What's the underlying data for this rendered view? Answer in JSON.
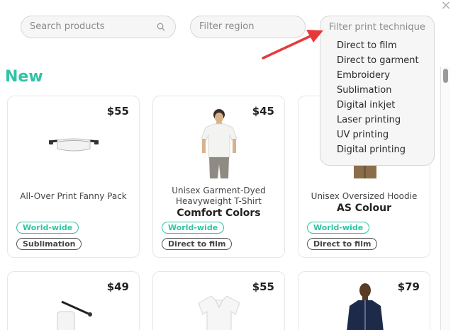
{
  "search": {
    "placeholder": "Search products"
  },
  "region_filter": {
    "placeholder": "Filter region"
  },
  "technique_filter": {
    "placeholder": "Filter print technique",
    "options": [
      "Direct to film",
      "Direct to garment",
      "Embroidery",
      "Sublimation",
      "Digital inkjet",
      "Laser printing",
      "UV printing",
      "Digital printing"
    ]
  },
  "section": {
    "title": "New"
  },
  "products": [
    {
      "price": "$55",
      "name": "All-Over Print Fanny Pack",
      "brand": "",
      "region": "World-wide",
      "technique": "Sublimation"
    },
    {
      "price": "$45",
      "name": "Unisex Garment-Dyed Heavyweight T-Shirt",
      "brand": "Comfort Colors",
      "region": "World-wide",
      "technique": "Direct to film"
    },
    {
      "price": "",
      "name": "Unisex Oversized Hoodie",
      "brand": "AS Colour",
      "region": "World-wide",
      "technique": "Direct to film"
    },
    {
      "price": "$49"
    },
    {
      "price": "$55"
    },
    {
      "price": "$79"
    }
  ],
  "colors": {
    "accent": "#2ec4a6",
    "arrow": "#e8393a"
  }
}
